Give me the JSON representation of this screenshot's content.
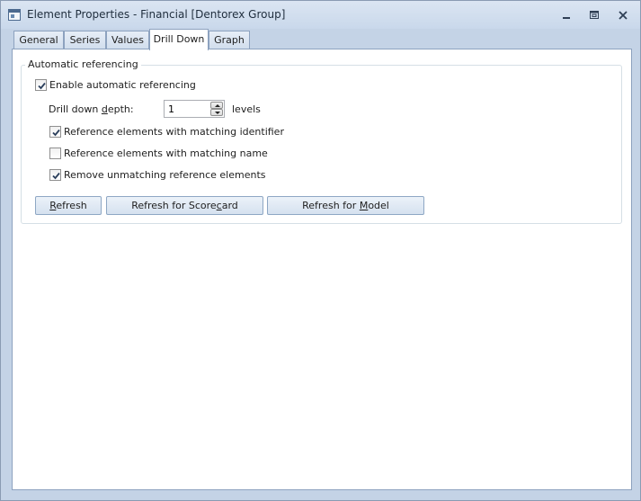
{
  "window": {
    "title": "Element Properties - Financial [Dentorex Group]",
    "icons": [
      "app-icon",
      "minimize-icon",
      "maximize-icon",
      "close-icon"
    ]
  },
  "tabs": [
    {
      "label": "General",
      "active": false
    },
    {
      "label": "Series",
      "active": false
    },
    {
      "label": "Values",
      "active": false
    },
    {
      "label": "Drill Down",
      "active": true
    },
    {
      "label": "Graph",
      "active": false
    }
  ],
  "group": {
    "title": "Automatic referencing",
    "enable": {
      "label": "Enable automatic referencing",
      "checked": true
    },
    "depth": {
      "label_pre": "Drill down ",
      "label_u": "d",
      "label_post": "epth:",
      "value": "1",
      "units": "levels"
    },
    "options": [
      {
        "label": "Reference elements with matching identifier",
        "checked": true
      },
      {
        "label": "Reference elements with matching name",
        "checked": false
      },
      {
        "label": "Remove unmatching reference elements",
        "checked": true
      }
    ]
  },
  "buttons": {
    "refresh": {
      "pre": "",
      "u": "R",
      "post": "efresh"
    },
    "refresh_scorecard": {
      "pre": "Refresh for Score",
      "u": "c",
      "post": "ard"
    },
    "refresh_model": {
      "pre": "Refresh for ",
      "u": "M",
      "post": "odel"
    }
  },
  "colors": {
    "titlebar": "#c9d8eb",
    "frame": "#c4d3e6",
    "panel": "#ffffff",
    "check": "#2b3f5c"
  }
}
